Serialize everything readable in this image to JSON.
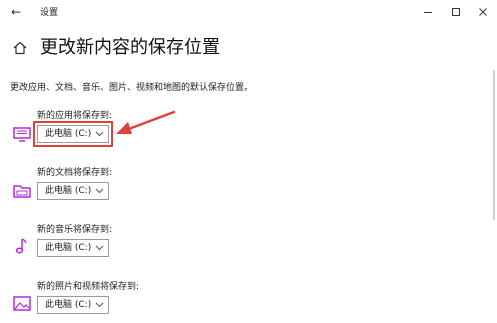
{
  "window": {
    "title": "设置",
    "back_glyph": "←",
    "controls": [
      "minimize-icon",
      "maximize-icon",
      "close-icon"
    ]
  },
  "page": {
    "title": "更改新内容的保存位置",
    "description": "更改应用、文档、音乐、图片、视频和地图的默认保存位置。",
    "home_icon": "home-icon"
  },
  "sections": [
    {
      "label": "新的应用将保存到:",
      "value": "此电脑 (C:)",
      "icon": "monitor-icon"
    },
    {
      "label": "新的文档将保存到:",
      "value": "此电脑 (C:)",
      "icon": "folder-icon"
    },
    {
      "label": "新的音乐将保存到:",
      "value": "此电脑 (C:)",
      "icon": "music-note-icon"
    },
    {
      "label": "新的照片和视频将保存到:",
      "value": "此电脑 (C:)",
      "icon": "image-icon"
    }
  ],
  "colors": {
    "accent": "#b22bd6",
    "highlight": "#e0413a"
  }
}
